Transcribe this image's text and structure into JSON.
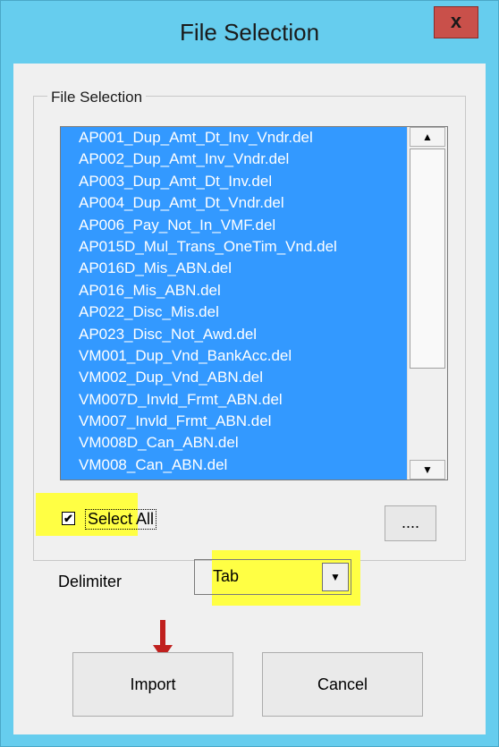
{
  "window": {
    "title": "File Selection",
    "close_label": "x"
  },
  "group": {
    "label": "File Selection"
  },
  "files": [
    "AP001_Dup_Amt_Dt_Inv_Vndr.del",
    "AP002_Dup_Amt_Inv_Vndr.del",
    "AP003_Dup_Amt_Dt_Inv.del",
    "AP004_Dup_Amt_Dt_Vndr.del",
    "AP006_Pay_Not_In_VMF.del",
    "AP015D_Mul_Trans_OneTim_Vnd.del",
    "AP016D_Mis_ABN.del",
    "AP016_Mis_ABN.del",
    "AP022_Disc_Mis.del",
    "AP023_Disc_Not_Awd.del",
    "VM001_Dup_Vnd_BankAcc.del",
    "VM002_Dup_Vnd_ABN.del",
    "VM007D_Invld_Frmt_ABN.del",
    "VM007_Invld_Frmt_ABN.del",
    "VM008D_Can_ABN.del",
    "VM008_Can_ABN.del"
  ],
  "select_all": {
    "label": "Select All",
    "checked": true
  },
  "browse": {
    "label": "...."
  },
  "delimiter": {
    "label": "Delimiter",
    "value": "Tab"
  },
  "buttons": {
    "import": "Import",
    "cancel": "Cancel"
  },
  "colors": {
    "title_bar": "#66cdee",
    "selection": "#3399ff",
    "highlight": "#ffff44",
    "annotation_arrow": "#c0201e"
  }
}
